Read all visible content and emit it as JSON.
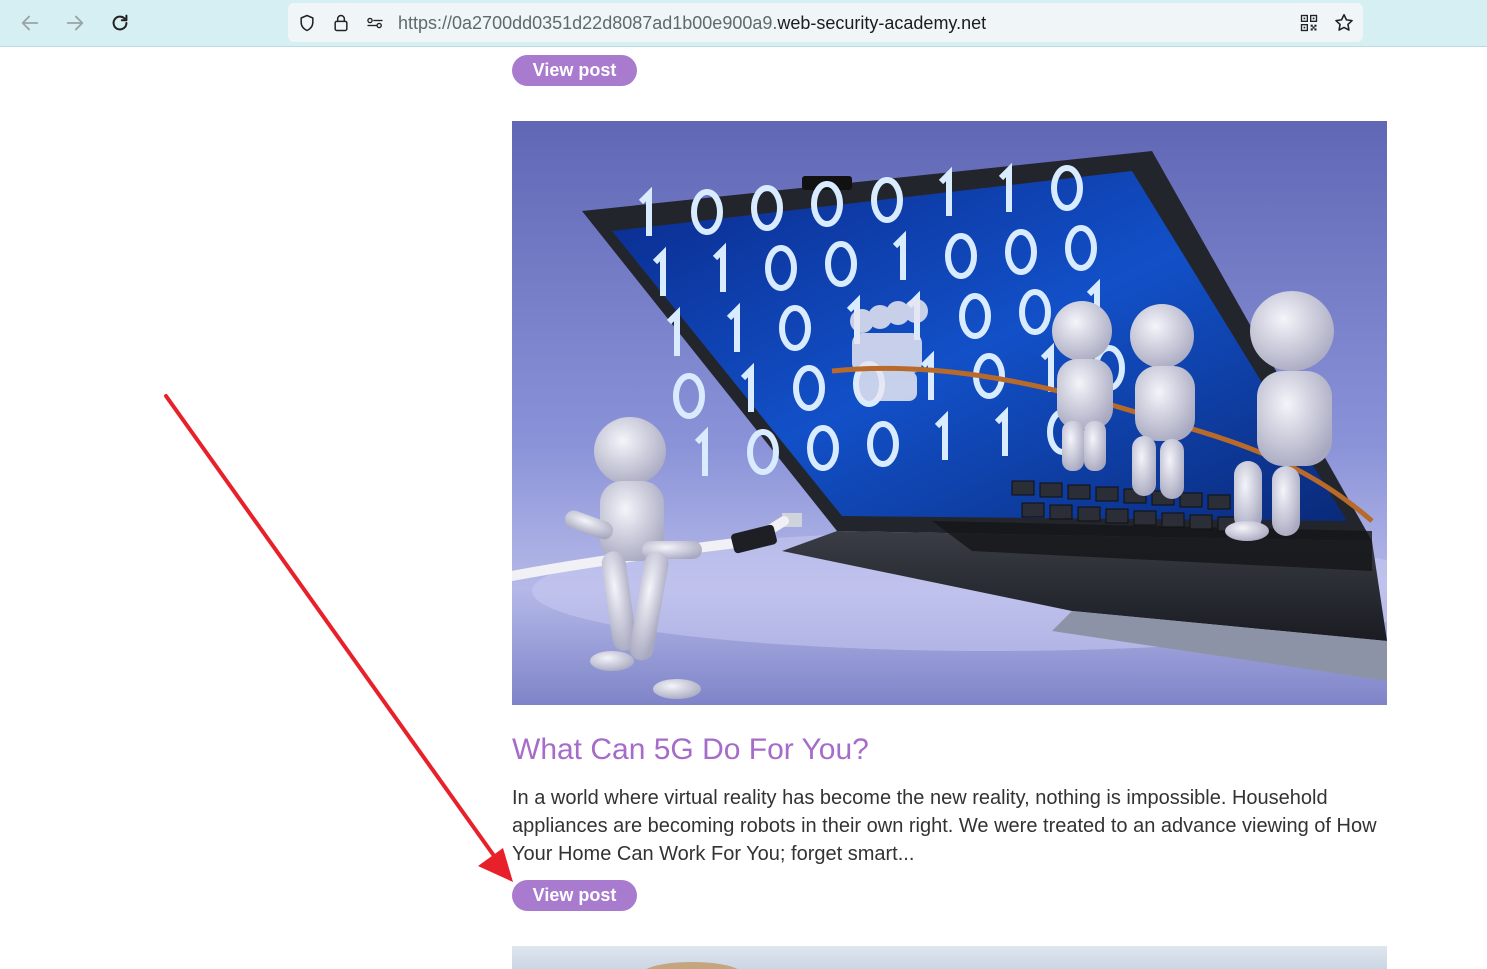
{
  "browser": {
    "url_prefix": "https://0a2700dd0351d22d8087ad1b00e900a9.",
    "url_domain": "web-security-academy.net",
    "icons": [
      "back-arrow-icon",
      "forward-arrow-icon",
      "reload-icon",
      "shield-icon",
      "lock-icon",
      "permissions-icon",
      "qr-code-icon",
      "star-icon"
    ]
  },
  "prev_post": {
    "button_label": "View post"
  },
  "post": {
    "title": "What Can 5G Do For You?",
    "excerpt": "In a world where virtual reality has become the new reality, nothing is impossible. Household appliances are becoming robots in their own right. We were treated to an advance viewing of How Your Home Can Work For You; forget smart...",
    "button_label": "View post",
    "image_subject": "figures pulling a rope out of a laptop screen showing binary digits",
    "binary_digits": [
      "1",
      "0",
      "0",
      "0",
      "0",
      "1",
      "1",
      "0",
      "1",
      "1",
      "0",
      "0",
      "1",
      "0",
      "0",
      "0",
      "1",
      "1",
      "0",
      "1",
      "1",
      "0",
      "0",
      "1",
      "0",
      "1",
      "0",
      "0",
      "1",
      "0",
      "1",
      "0",
      "1",
      "0",
      "0",
      "0",
      "1",
      "1",
      "0"
    ]
  },
  "colors": {
    "accent": "#a87bce",
    "title": "#a56cc9",
    "toolbar": "#d6eff2",
    "annotation_arrow": "#e8202a"
  }
}
